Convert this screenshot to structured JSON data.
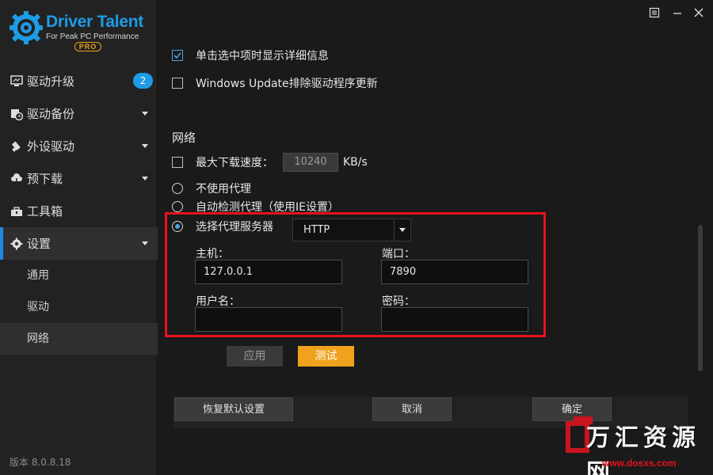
{
  "app": {
    "logo_title": "Driver Talent",
    "logo_subtitle": "For Peak PC Performance",
    "logo_badge": "PRO",
    "version": "版本 8.0.8.18"
  },
  "sidebar": {
    "items": [
      {
        "label": "驱动升级",
        "icon": "monitor-icon",
        "badge": "2"
      },
      {
        "label": "驱动备份",
        "icon": "backup-clock-icon"
      },
      {
        "label": "外设驱动",
        "icon": "usb-icon"
      },
      {
        "label": "预下载",
        "icon": "cloud-download-icon"
      },
      {
        "label": "工具箱",
        "icon": "toolbox-icon"
      },
      {
        "label": "设置",
        "icon": "gear-icon"
      }
    ],
    "settings_subitems": [
      "通用",
      "驱动",
      "网络"
    ]
  },
  "options": {
    "show_details": "单击选中项时显示详细信息",
    "windows_update": "Windows Update排除驱动程序更新"
  },
  "network": {
    "section_title": "网络",
    "max_speed_label": "最大下载速度：",
    "max_speed_value": "10240",
    "max_speed_unit": "KB/s",
    "no_proxy": "不使用代理",
    "auto_proxy": "自动检测代理（使用IE设置）",
    "manual_proxy": "选择代理服务器",
    "proxy_type": "HTTP",
    "host_label": "主机：",
    "host_value": "127.0.0.1",
    "port_label": "端口：",
    "port_value": "7890",
    "username_label": "用户名：",
    "username_value": "",
    "password_label": "密码：",
    "password_value": ""
  },
  "buttons": {
    "apply": "应用",
    "test": "测试",
    "restore_defaults": "恢复默认设置",
    "cancel": "取消",
    "ok": "确定"
  },
  "watermark": {
    "text": "万汇资源网",
    "url": "www.dosxs.com"
  },
  "colors": {
    "accent_blue": "#1e9be5",
    "test_orange": "#f0a21c",
    "highlight_red": "#e8111c"
  }
}
